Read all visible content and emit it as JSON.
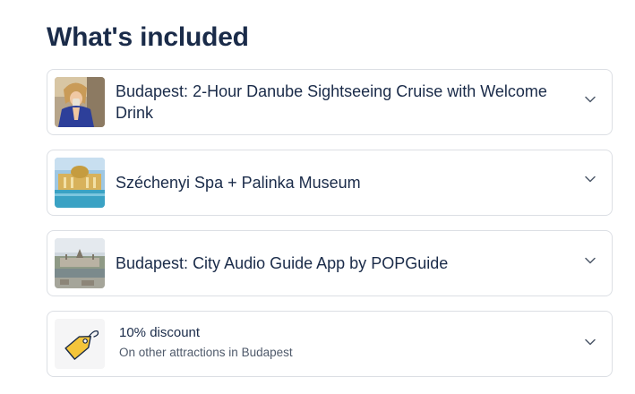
{
  "section": {
    "title": "What's included"
  },
  "items": [
    {
      "title": "Budapest: 2-Hour Danube Sightseeing Cruise with Welcome Drink",
      "thumbnail": "woman-drinking-photo"
    },
    {
      "title": "Széchenyi Spa + Palinka Museum",
      "thumbnail": "spa-building-photo"
    },
    {
      "title": "Budapest: City Audio Guide App by POPGuide",
      "thumbnail": "parliament-city-photo"
    },
    {
      "title": "10% discount",
      "subtitle": "On other attractions in Budapest",
      "icon": "price-tag-icon"
    }
  ],
  "icons": {
    "expand": "chevron-down-icon"
  },
  "colors": {
    "text": "#1a2b49",
    "subtext": "#4f5a6b",
    "border": "#dcdfe4",
    "tag": "#f4c53b"
  }
}
